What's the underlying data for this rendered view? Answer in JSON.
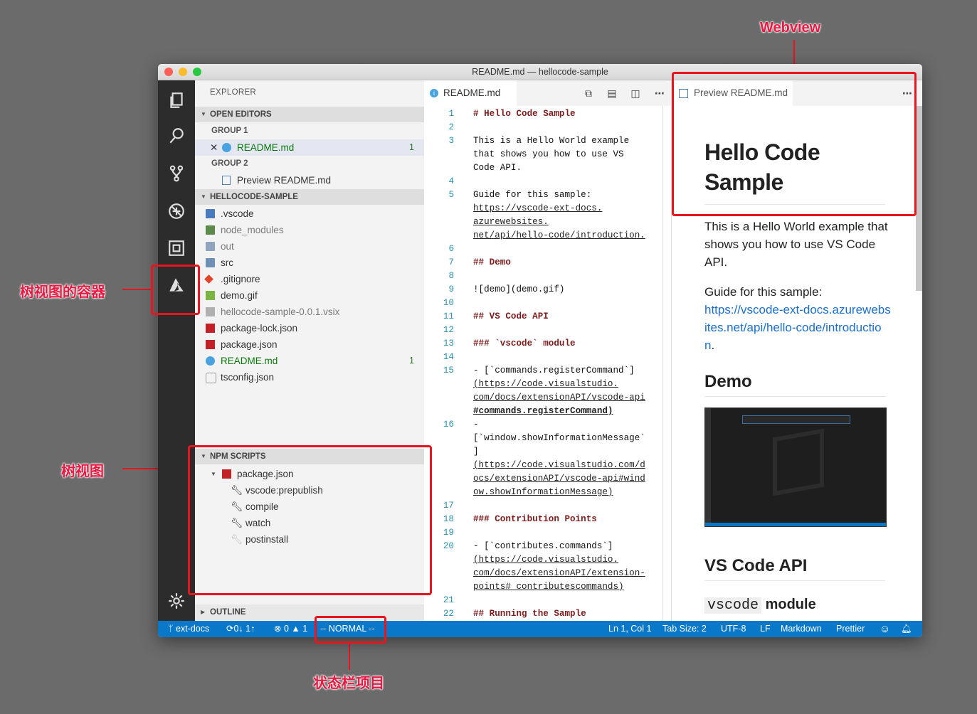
{
  "window": {
    "title": "README.md — hellocode-sample"
  },
  "annotations": {
    "webview": "Webview",
    "tree_container": "树视图的容器",
    "tree_view": "树视图",
    "status_item": "状态栏项目"
  },
  "sidebar": {
    "title": "EXPLORER",
    "open_editors": {
      "header": "OPEN EDITORS",
      "group1": "GROUP 1",
      "group1_file": "README.md",
      "group1_badge": "1",
      "group2": "GROUP 2",
      "group2_file": "Preview README.md"
    },
    "project": {
      "header": "HELLOCODE-SAMPLE",
      "items": [
        {
          "name": ".vscode",
          "icon": "folder-vscode-icon"
        },
        {
          "name": "node_modules",
          "icon": "folder-node-icon"
        },
        {
          "name": "out",
          "icon": "folder-icon"
        },
        {
          "name": "src",
          "icon": "folder-src-icon"
        },
        {
          "name": ".gitignore",
          "icon": "git-icon"
        },
        {
          "name": "demo.gif",
          "icon": "image-icon"
        },
        {
          "name": "hellocode-sample-0.0.1.vsix",
          "icon": "file-icon"
        },
        {
          "name": "package-lock.json",
          "icon": "npm-icon"
        },
        {
          "name": "package.json",
          "icon": "npm-icon"
        },
        {
          "name": "README.md",
          "icon": "info-icon",
          "badge": "1"
        },
        {
          "name": "tsconfig.json",
          "icon": "braces-icon"
        }
      ]
    },
    "npm": {
      "header": "NPM SCRIPTS",
      "package": "package.json",
      "scripts": [
        "vscode:prepublish",
        "compile",
        "watch",
        "postinstall"
      ]
    },
    "outline": {
      "header": "OUTLINE"
    }
  },
  "editor": {
    "tab": "README.md",
    "lines": [
      {
        "n": "1",
        "t": "# Hello Code Sample"
      },
      {
        "n": "2",
        "t": ""
      },
      {
        "n": "3",
        "t": "This is a Hello World example"
      },
      {
        "n": "",
        "t": "that shows you how to use VS"
      },
      {
        "n": "",
        "t": "Code API."
      },
      {
        "n": "4",
        "t": ""
      },
      {
        "n": "5",
        "t": "Guide for this sample:"
      },
      {
        "n": "",
        "t": "https://vscode-ext-docs."
      },
      {
        "n": "",
        "t": "azurewebsites."
      },
      {
        "n": "",
        "t": "net/api/hello-code/introduction."
      },
      {
        "n": "6",
        "t": ""
      },
      {
        "n": "7",
        "t": "## Demo"
      },
      {
        "n": "8",
        "t": ""
      },
      {
        "n": "9",
        "t": "![demo](demo.gif)"
      },
      {
        "n": "10",
        "t": ""
      },
      {
        "n": "11",
        "t": "## VS Code API"
      },
      {
        "n": "12",
        "t": ""
      },
      {
        "n": "13",
        "t": "### `vscode` module"
      },
      {
        "n": "14",
        "t": ""
      },
      {
        "n": "15",
        "t": "- [`commands.registerCommand`]"
      },
      {
        "n": "",
        "t": "(https://code.visualstudio."
      },
      {
        "n": "",
        "t": "com/docs/extensionAPI/vscode-api"
      },
      {
        "n": "",
        "t": "#commands.registerCommand)"
      },
      {
        "n": "16",
        "t": "-"
      },
      {
        "n": "",
        "t": "[`window.showInformationMessage`"
      },
      {
        "n": "",
        "t": "]"
      },
      {
        "n": "",
        "t": "(https://code.visualstudio.com/d"
      },
      {
        "n": "",
        "t": "ocs/extensionAPI/vscode-api#wind"
      },
      {
        "n": "",
        "t": "ow.showInformationMessage)"
      },
      {
        "n": "17",
        "t": ""
      },
      {
        "n": "18",
        "t": "### Contribution Points"
      },
      {
        "n": "19",
        "t": ""
      },
      {
        "n": "20",
        "t": "- [`contributes.commands`]"
      },
      {
        "n": "",
        "t": "(https://code.visualstudio."
      },
      {
        "n": "",
        "t": "com/docs/extensionAPI/extension-"
      },
      {
        "n": "",
        "t": "points#_contributescommands)"
      },
      {
        "n": "21",
        "t": ""
      },
      {
        "n": "22",
        "t": "## Running the Sample"
      }
    ]
  },
  "preview": {
    "tab": "Preview README.md",
    "h1": "Hello Code Sample",
    "p1": "This is a Hello World example that shows you how to use VS Code API.",
    "p2": "Guide for this sample:",
    "link": "https://vscode-ext-docs.azurewebsites.net/api/hello-code/introduction",
    "link_suffix": ".",
    "h2_demo": "Demo",
    "h2_api": "VS Code API",
    "h3_code": "vscode",
    "h3_rest": " module"
  },
  "statusbar": {
    "branch": "ext-docs",
    "sync": "0↓ 1↑",
    "errors": "0",
    "warnings": "1",
    "mode": "-- NORMAL --",
    "position": "Ln 1, Col 1",
    "tab_size": "Tab Size: 2",
    "encoding": "UTF-8",
    "eol": "LF",
    "language": "Markdown",
    "formatter": "Prettier"
  },
  "colors": {
    "statusbar": "#0a78c9",
    "accent_red": "#e8141e"
  }
}
